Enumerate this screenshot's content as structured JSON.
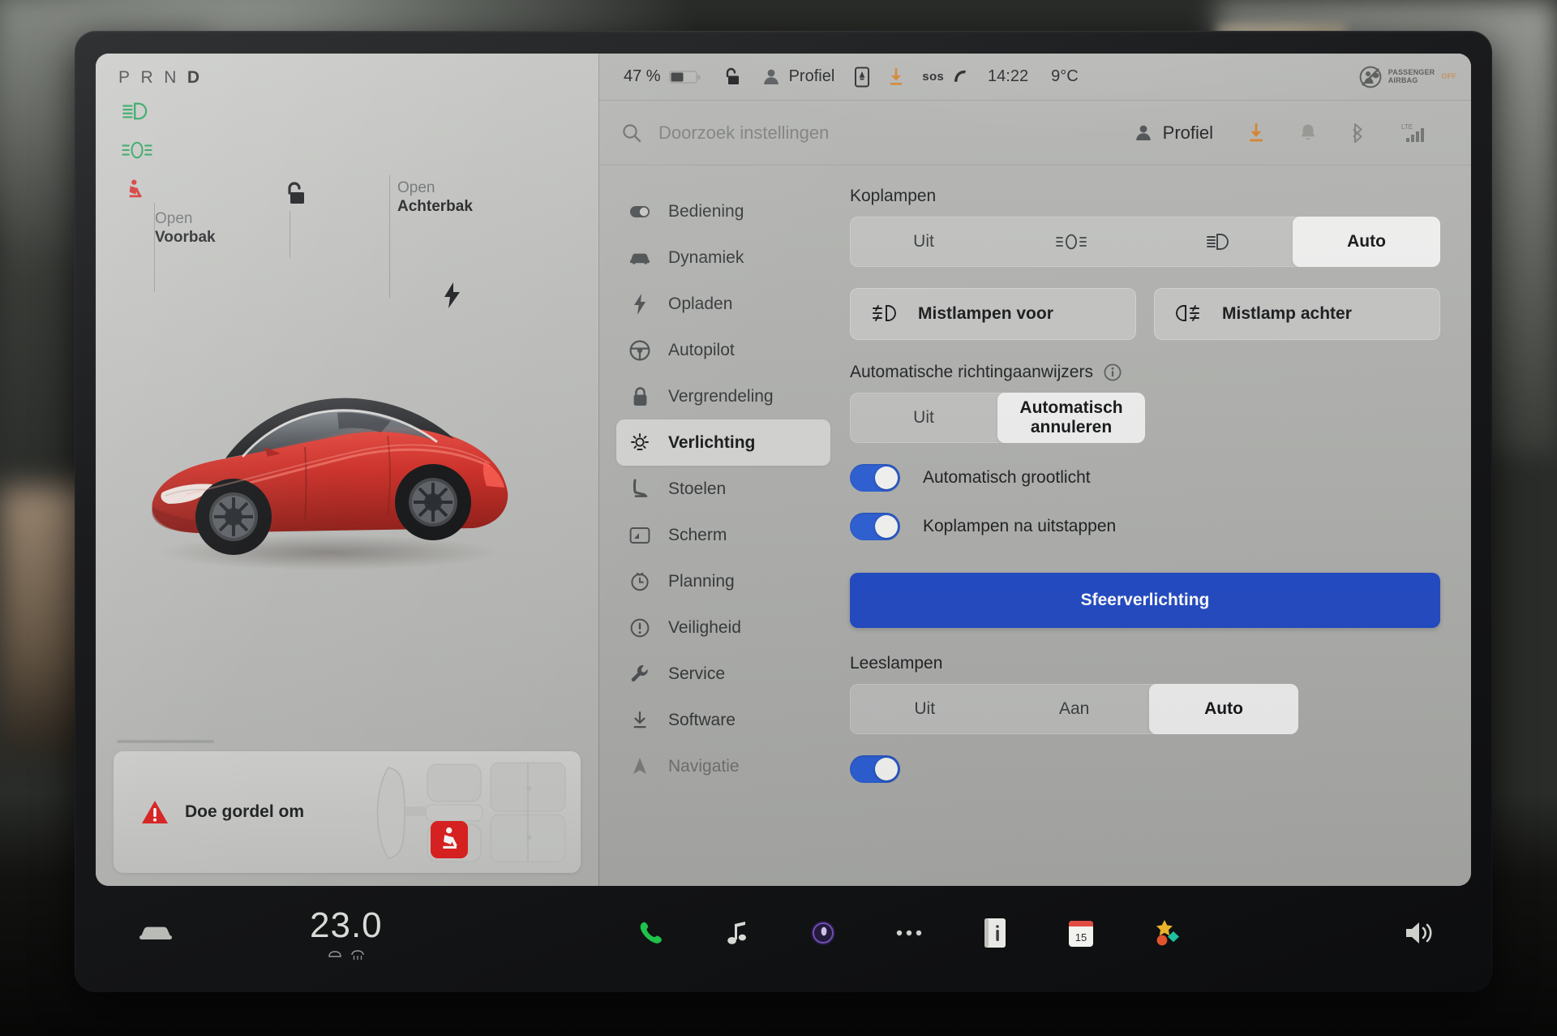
{
  "instrument": {
    "gear_positions": [
      "P",
      "R",
      "N",
      "D"
    ],
    "active_gear": "D",
    "telltales": [
      {
        "name": "low-beam-telltale",
        "color": "#1f9e55"
      },
      {
        "name": "parking-lights-telltale",
        "color": "#1f9e55"
      },
      {
        "name": "seatbelt-telltale",
        "color": "#d22b2b"
      }
    ]
  },
  "car_panel": {
    "front_trunk": {
      "sub": "Open",
      "main": "Voorbak"
    },
    "rear_trunk": {
      "sub": "Open",
      "main": "Achterbak"
    },
    "unlock_icon": "unlock-icon",
    "charge_icon": "charge-port-bolt-icon",
    "alert": {
      "icon": "warning-triangle-icon",
      "text": "Doe gordel om",
      "color": "#e01f1f"
    }
  },
  "statusbar": {
    "battery_percent": "47 %",
    "battery_icon": "battery-icon",
    "lock_icon": "unlock-icon",
    "profile_icon": "person-icon",
    "profile_label": "Profiel",
    "phone_icon": "phone-card-icon",
    "download_icon": "software-download-icon",
    "sos_label": "sos",
    "sos_icon": "phone-handset-icon",
    "time": "14:22",
    "temperature": "9°C",
    "airbag": {
      "icon": "passenger-airbag-off-icon",
      "line1": "PASSENGER",
      "line2": "AIRBAG",
      "state": "OFF"
    }
  },
  "toolbar": {
    "search_icon": "search-icon",
    "search_placeholder": "Doorzoek instellingen",
    "profile_icon": "person-icon",
    "profile_label": "Profiel",
    "download_icon": "software-download-icon",
    "bell_icon": "bell-icon",
    "bluetooth_icon": "bluetooth-icon",
    "signal_label": "LTE",
    "signal_icon": "signal-bars-icon"
  },
  "sidebar": {
    "items": [
      {
        "label": "Bediening",
        "icon": "toggle-switch-icon",
        "selected": false
      },
      {
        "label": "Dynamiek",
        "icon": "car-front-icon",
        "selected": false
      },
      {
        "label": "Opladen",
        "icon": "lightning-bolt-icon",
        "selected": false
      },
      {
        "label": "Autopilot",
        "icon": "steering-wheel-icon",
        "selected": false
      },
      {
        "label": "Vergrendeling",
        "icon": "lock-icon",
        "selected": false
      },
      {
        "label": "Verlichting",
        "icon": "light-bulb-icon",
        "selected": true
      },
      {
        "label": "Stoelen",
        "icon": "seat-icon",
        "selected": false
      },
      {
        "label": "Scherm",
        "icon": "display-icon",
        "selected": false
      },
      {
        "label": "Planning",
        "icon": "clock-schedule-icon",
        "selected": false
      },
      {
        "label": "Veiligheid",
        "icon": "exclamation-circle-icon",
        "selected": false
      },
      {
        "label": "Service",
        "icon": "wrench-icon",
        "selected": false
      },
      {
        "label": "Software",
        "icon": "download-icon",
        "selected": false
      },
      {
        "label": "Navigatie",
        "icon": "navigation-arrow-icon",
        "selected": false
      }
    ]
  },
  "settings": {
    "headlights": {
      "title": "Koplampen",
      "options": [
        {
          "label": "Uit",
          "icon": null,
          "selected": false
        },
        {
          "label": "",
          "icon": "parking-lights-icon",
          "selected": false
        },
        {
          "label": "",
          "icon": "low-beam-icon",
          "selected": false
        },
        {
          "label": "Auto",
          "icon": null,
          "selected": true
        }
      ]
    },
    "fog_buttons": [
      {
        "label": "Mistlampen voor",
        "icon": "front-fog-lamp-icon"
      },
      {
        "label": "Mistlamp achter",
        "icon": "rear-fog-lamp-icon"
      }
    ],
    "turn_signals": {
      "title": "Automatische richtingaanwijzers",
      "info_icon": "info-circle-icon",
      "options": [
        {
          "label": "Uit",
          "selected": false
        },
        {
          "label": "Automatisch annuleren",
          "selected": true
        }
      ]
    },
    "toggles": [
      {
        "label": "Automatisch grootlicht",
        "on": true
      },
      {
        "label": "Koplampen na uitstappen",
        "on": true
      }
    ],
    "ambient_button": {
      "label": "Sfeerverlichting",
      "color": "#2149c4"
    },
    "reading_lights": {
      "title": "Leeslampen",
      "options": [
        {
          "label": "Uit",
          "selected": false
        },
        {
          "label": "Aan",
          "selected": false
        },
        {
          "label": "Auto",
          "selected": true
        }
      ]
    }
  },
  "dock": {
    "car_icon": "car-icon",
    "temperature": "23.0",
    "temp_icons": [
      "fan-icon",
      "defrost-icon"
    ],
    "apps": [
      {
        "name": "phone-icon",
        "color": "#1fc24a"
      },
      {
        "name": "music-note-icon",
        "color": "#d7d9d5"
      },
      {
        "name": "voice-assistant-icon",
        "color": "#7b5cc4"
      },
      {
        "name": "more-dots-icon",
        "color": "#cfd1cd"
      },
      {
        "name": "info-app-icon",
        "color": "#e8e9e5"
      },
      {
        "name": "calendar-icon",
        "label": "15",
        "color": "#e24b42"
      },
      {
        "name": "toybox-app-icon",
        "color": "#e8b32a"
      }
    ],
    "volume_icon": "volume-icon"
  }
}
